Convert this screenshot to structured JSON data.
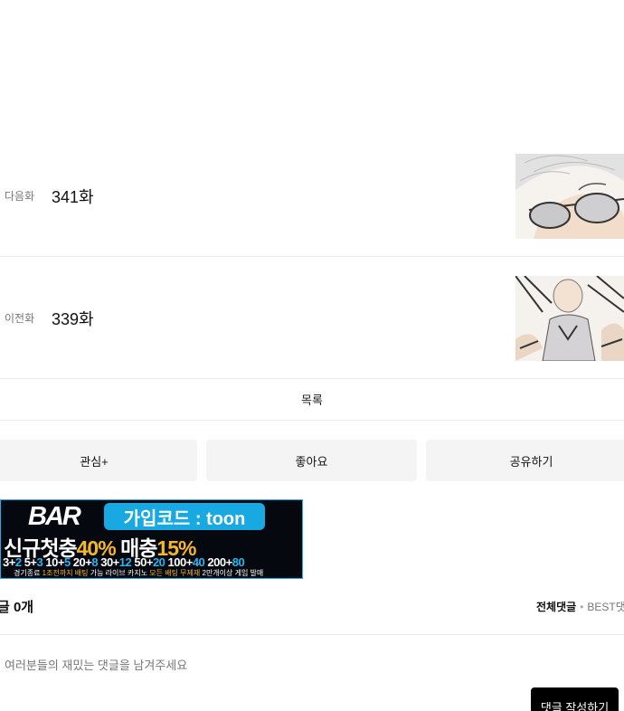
{
  "episodes": {
    "next": {
      "kind_label": "다음화",
      "title": "341화"
    },
    "prev": {
      "kind_label": "이전화",
      "title": "339화"
    }
  },
  "list_button": "목록",
  "actions": {
    "favorite": "관심+",
    "like": "좋아요",
    "share": "공유하기"
  },
  "banner": {
    "logo": "BAR",
    "code_text": "가입코드 : toon",
    "headline_first": "신규첫충",
    "headline_first_pct": "40%",
    "headline_second": "매충",
    "headline_second_pct": "15%",
    "bonus": [
      {
        "base": "3+",
        "extra": "2"
      },
      {
        "base": "5+",
        "extra": "3"
      },
      {
        "base": "10+",
        "extra": "5"
      },
      {
        "base": "20+",
        "extra": "8"
      },
      {
        "base": "30+",
        "extra": "12"
      },
      {
        "base": "50+",
        "extra": "20"
      },
      {
        "base": "100+",
        "extra": "40"
      },
      {
        "base": "200+",
        "extra": "80"
      }
    ],
    "fine_a": "경기종료 ",
    "fine_b": "1조전까지 배팅",
    "fine_c": " 가능 라이브 카지노 ",
    "fine_d": "모든 배팅 무제재",
    "fine_e": " 2만개이상 게임 발매"
  },
  "comments": {
    "count_label": "글 0개",
    "sort_all": "전체댓글",
    "sort_best": "BEST댓",
    "input_placeholder": "여러분들의 재밌는 댓글을 남겨주세요",
    "write_button": "댓글 작성하기"
  }
}
